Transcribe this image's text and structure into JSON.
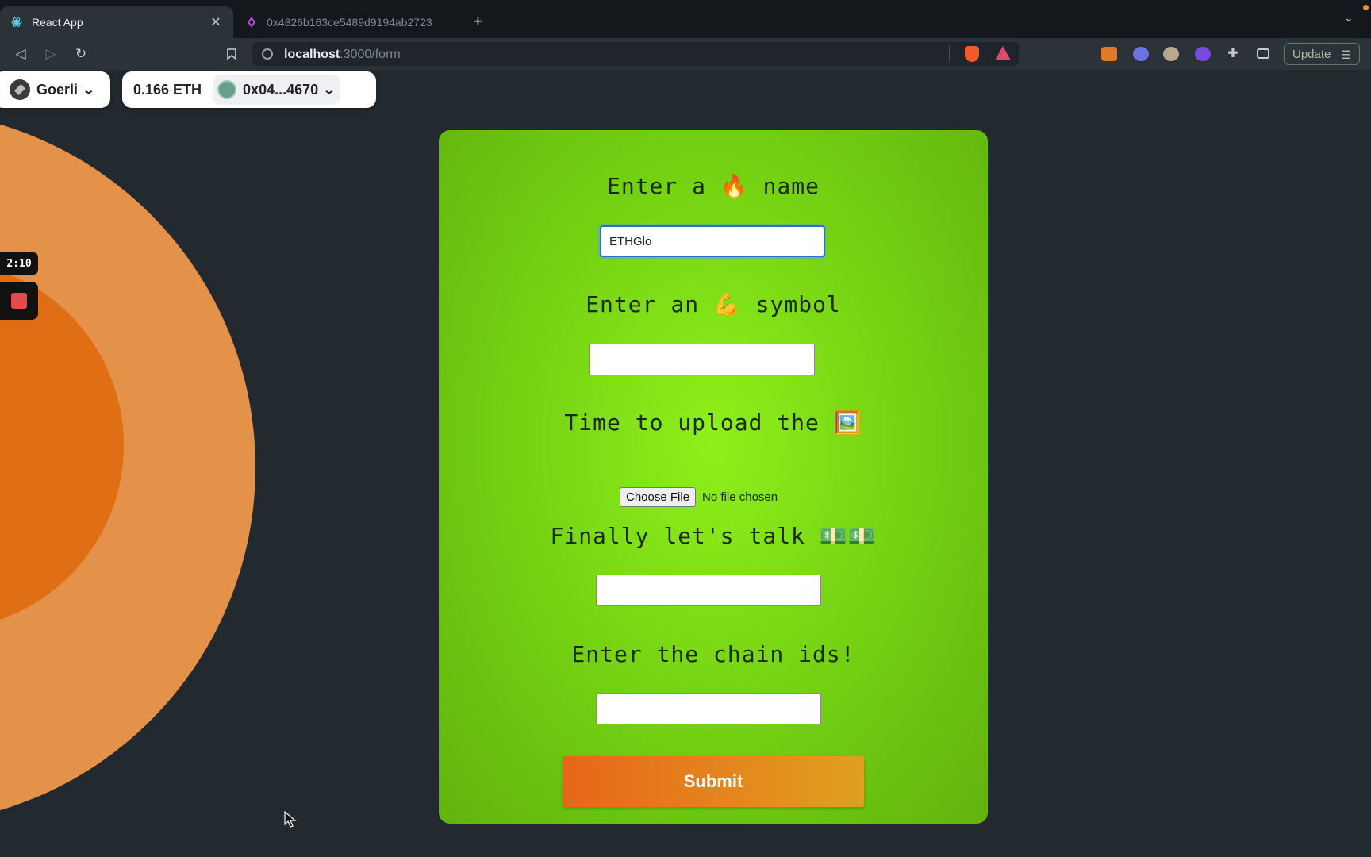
{
  "browser": {
    "tabs": [
      {
        "title": "React App",
        "active": true
      },
      {
        "title": "0x4826b163ce5489d9194ab2723",
        "active": false
      }
    ],
    "url_host": "localhost",
    "url_path": ":3000/form",
    "update_label": "Update"
  },
  "wallet": {
    "network": "Goerli",
    "balance": "0.166 ETH",
    "address": "0x04...4670"
  },
  "recorder": {
    "time": "2:10"
  },
  "form": {
    "name_prompt": "Enter a 🔥 name",
    "name_value": "ETHGlo",
    "symbol_prompt": "Enter an 💪 symbol",
    "symbol_value": "",
    "image_prompt": "Time to upload the 🖼️",
    "file_button": "Choose File",
    "file_status": "No file chosen",
    "money_prompt": "Finally let's talk 💵💵",
    "money_value": "",
    "chain_prompt": "Enter the chain ids!",
    "chain_value": "",
    "submit_label": "Submit"
  },
  "colors": {
    "card_green": "#7fdc14",
    "submit_orange": "#e8661a",
    "outer_ring": "#e4914a",
    "inner_ring": "#e06e14"
  }
}
